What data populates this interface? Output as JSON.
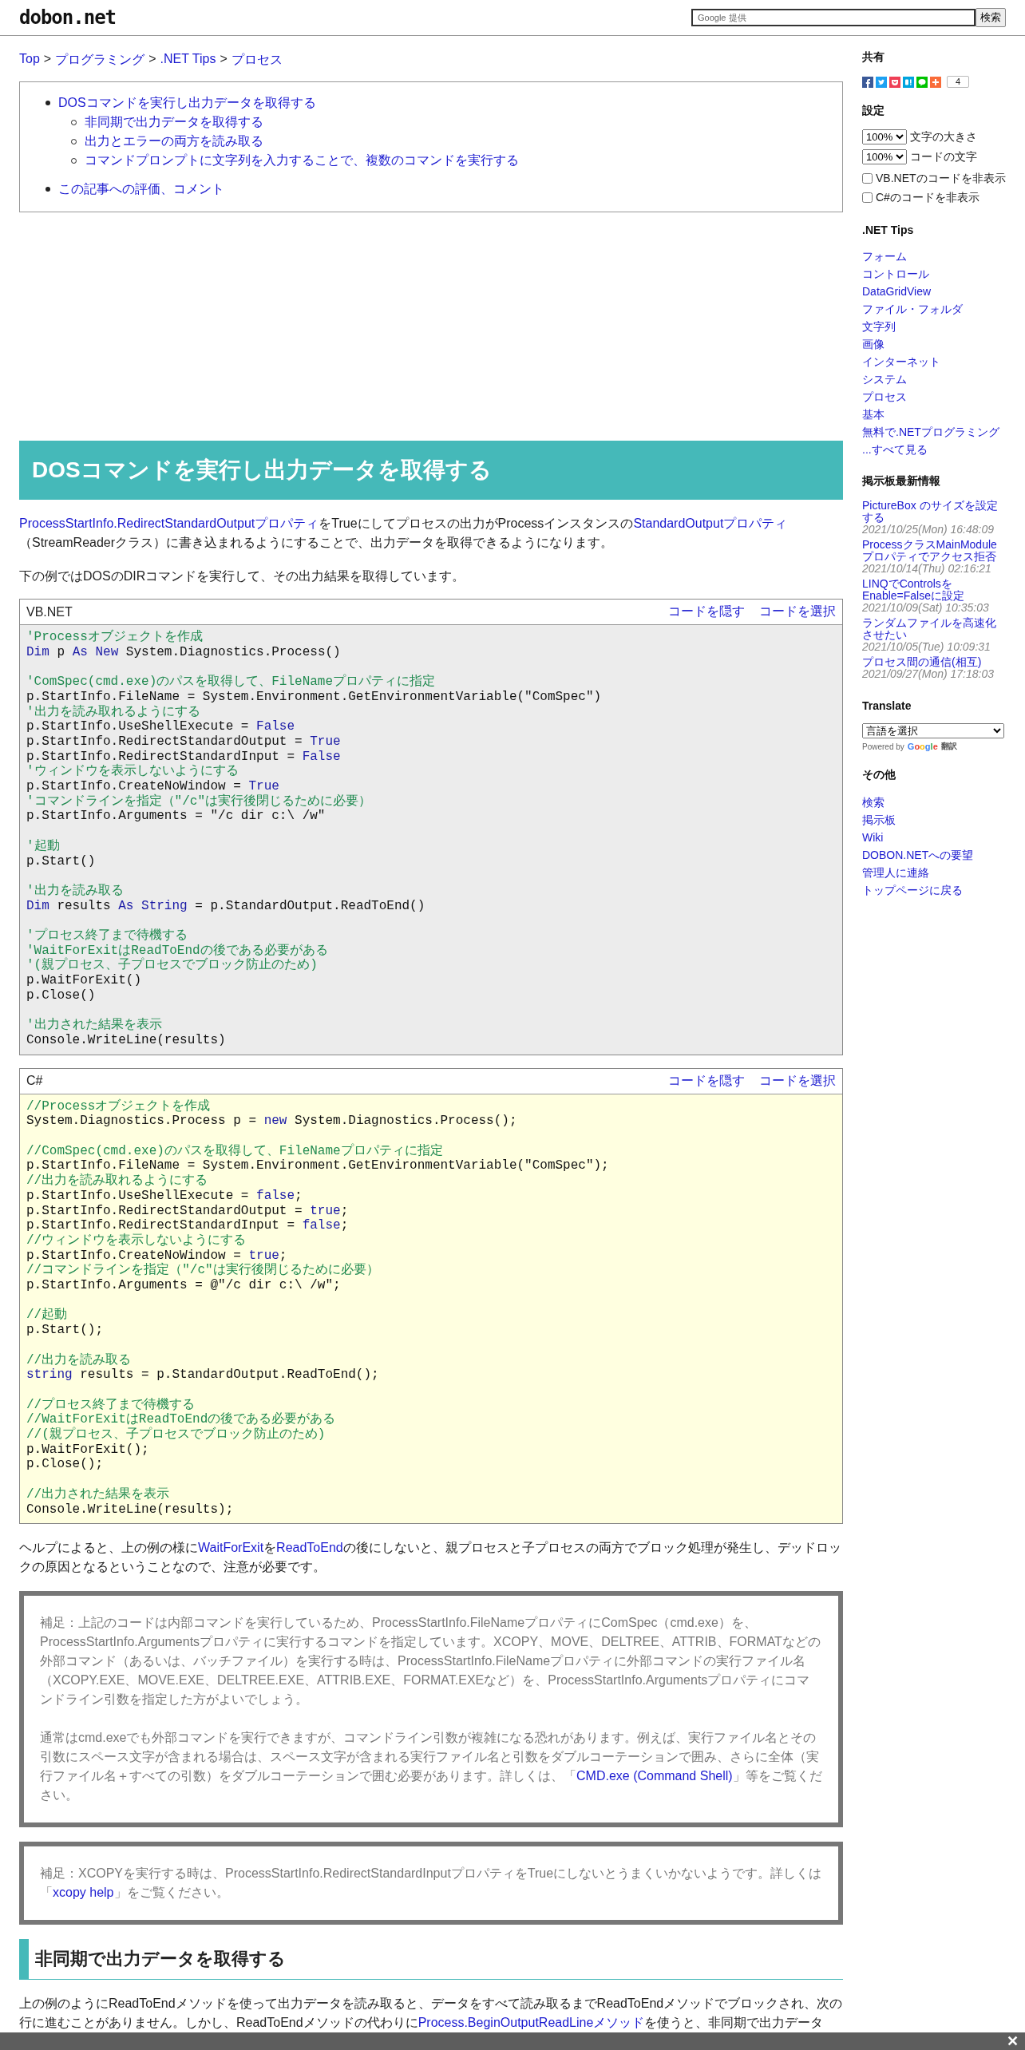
{
  "header": {
    "logo": "dobon.net",
    "search": {
      "placeholder": "Google 提供"
    },
    "search_button": "検索"
  },
  "breadcrumb": {
    "separator": ">",
    "items": [
      {
        "label": "Top"
      },
      {
        "label": "プログラミング"
      },
      {
        "label": ".NET Tips"
      },
      {
        "label": "プロセス"
      }
    ]
  },
  "toc": [
    {
      "label": "DOSコマンドを実行し出力データを取得する",
      "children": [
        {
          "label": "非同期で出力データを取得する"
        },
        {
          "label": "出力とエラーの両方を読み取る"
        },
        {
          "label": "コマンドプロンプトに文字列を入力することで、複数のコマンドを実行する"
        }
      ]
    },
    {
      "label": "この記事への評価、コメント"
    }
  ],
  "article": {
    "heading": "DOSコマンドを実行し出力データを取得する",
    "blocks": [
      {
        "kind": "paragraph",
        "segments": [
          {
            "kind": "link",
            "text": "ProcessStartInfo.RedirectStandardOutputプロパティ"
          },
          {
            "kind": "text",
            "text": "をTrueにしてプロセスの出力がProcessインスタンスの"
          },
          {
            "kind": "link",
            "text": "StandardOutputプロパティ"
          },
          {
            "kind": "text",
            "text": "（StreamReaderクラス）に書き込まれるようにすることで、出力データを取得できるようになります。"
          }
        ]
      },
      {
        "kind": "paragraph",
        "segments": [
          {
            "kind": "text",
            "text": "下の例ではDOSのDIRコマンドを実行して、その出力結果を取得しています。"
          }
        ]
      },
      {
        "kind": "code",
        "language": "VB.NET",
        "color": "#ececec",
        "actions": [
          "コードを隠す",
          "コードを選択"
        ],
        "lines": [
          {
            "kind": "code",
            "tokens": [
              {
                "kind": "comment",
                "text": "'Processオブジェクトを作成"
              }
            ]
          },
          {
            "kind": "code",
            "tokens": [
              {
                "kind": "keyword",
                "text": "Dim"
              },
              {
                "kind": "plain",
                "text": " p "
              },
              {
                "kind": "keyword",
                "text": "As New"
              },
              {
                "kind": "plain",
                "text": " System.Diagnostics.Process()"
              }
            ]
          },
          {
            "kind": "blank"
          },
          {
            "kind": "code",
            "tokens": [
              {
                "kind": "comment",
                "text": "'ComSpec(cmd.exe)のパスを取得して、FileNameプロパティに指定"
              }
            ]
          },
          {
            "kind": "code",
            "tokens": [
              {
                "kind": "plain",
                "text": "p.StartInfo.FileName = System.Environment.GetEnvironmentVariable(\"ComSpec\")"
              }
            ]
          },
          {
            "kind": "code",
            "tokens": [
              {
                "kind": "comment",
                "text": "'出力を読み取れるようにする"
              }
            ]
          },
          {
            "kind": "code",
            "tokens": [
              {
                "kind": "plain",
                "text": "p.StartInfo.UseShellExecute = "
              },
              {
                "kind": "keyword",
                "text": "False"
              }
            ]
          },
          {
            "kind": "code",
            "tokens": [
              {
                "kind": "plain",
                "text": "p.StartInfo.RedirectStandardOutput = "
              },
              {
                "kind": "keyword",
                "text": "True"
              }
            ]
          },
          {
            "kind": "code",
            "tokens": [
              {
                "kind": "plain",
                "text": "p.StartInfo.RedirectStandardInput = "
              },
              {
                "kind": "keyword",
                "text": "False"
              }
            ]
          },
          {
            "kind": "code",
            "tokens": [
              {
                "kind": "comment",
                "text": "'ウィンドウを表示しないようにする"
              }
            ]
          },
          {
            "kind": "code",
            "tokens": [
              {
                "kind": "plain",
                "text": "p.StartInfo.CreateNoWindow = "
              },
              {
                "kind": "keyword",
                "text": "True"
              }
            ]
          },
          {
            "kind": "code",
            "tokens": [
              {
                "kind": "comment",
                "text": "'コマンドラインを指定（\"/c\"は実行後閉じるために必要）"
              }
            ]
          },
          {
            "kind": "code",
            "tokens": [
              {
                "kind": "plain",
                "text": "p.StartInfo.Arguments = \"/c dir c:\\ /w\""
              }
            ]
          },
          {
            "kind": "blank"
          },
          {
            "kind": "code",
            "tokens": [
              {
                "kind": "comment",
                "text": "'起動"
              }
            ]
          },
          {
            "kind": "code",
            "tokens": [
              {
                "kind": "plain",
                "text": "p.Start()"
              }
            ]
          },
          {
            "kind": "blank"
          },
          {
            "kind": "code",
            "tokens": [
              {
                "kind": "comment",
                "text": "'出力を読み取る"
              }
            ]
          },
          {
            "kind": "code",
            "tokens": [
              {
                "kind": "keyword",
                "text": "Dim"
              },
              {
                "kind": "plain",
                "text": " results "
              },
              {
                "kind": "keyword",
                "text": "As String"
              },
              {
                "kind": "plain",
                "text": " = p.StandardOutput.ReadToEnd()"
              }
            ]
          },
          {
            "kind": "blank"
          },
          {
            "kind": "code",
            "tokens": [
              {
                "kind": "comment",
                "text": "'プロセス終了まで待機する"
              }
            ]
          },
          {
            "kind": "code",
            "tokens": [
              {
                "kind": "comment",
                "text": "'WaitForExitはReadToEndの後である必要がある"
              }
            ]
          },
          {
            "kind": "code",
            "tokens": [
              {
                "kind": "comment",
                "text": "'(親プロセス、子プロセスでブロック防止のため)"
              }
            ]
          },
          {
            "kind": "code",
            "tokens": [
              {
                "kind": "plain",
                "text": "p.WaitForExit()"
              }
            ]
          },
          {
            "kind": "code",
            "tokens": [
              {
                "kind": "plain",
                "text": "p.Close()"
              }
            ]
          },
          {
            "kind": "blank"
          },
          {
            "kind": "code",
            "tokens": [
              {
                "kind": "comment",
                "text": "'出力された結果を表示"
              }
            ]
          },
          {
            "kind": "code",
            "tokens": [
              {
                "kind": "plain",
                "text": "Console.WriteLine(results)"
              }
            ]
          }
        ]
      },
      {
        "kind": "code",
        "language": "C#",
        "color": "#ffffe0",
        "actions": [
          "コードを隠す",
          "コードを選択"
        ],
        "lines": [
          {
            "kind": "code",
            "tokens": [
              {
                "kind": "comment",
                "text": "//Processオブジェクトを作成"
              }
            ]
          },
          {
            "kind": "code",
            "tokens": [
              {
                "kind": "plain",
                "text": "System.Diagnostics.Process p = "
              },
              {
                "kind": "keyword",
                "text": "new"
              },
              {
                "kind": "plain",
                "text": " System.Diagnostics.Process();"
              }
            ]
          },
          {
            "kind": "blank"
          },
          {
            "kind": "code",
            "tokens": [
              {
                "kind": "comment",
                "text": "//ComSpec(cmd.exe)のパスを取得して、FileNameプロパティに指定"
              }
            ]
          },
          {
            "kind": "code",
            "tokens": [
              {
                "kind": "plain",
                "text": "p.StartInfo.FileName = System.Environment.GetEnvironmentVariable(\"ComSpec\");"
              }
            ]
          },
          {
            "kind": "code",
            "tokens": [
              {
                "kind": "comment",
                "text": "//出力を読み取れるようにする"
              }
            ]
          },
          {
            "kind": "code",
            "tokens": [
              {
                "kind": "plain",
                "text": "p.StartInfo.UseShellExecute = "
              },
              {
                "kind": "keyword",
                "text": "false"
              },
              {
                "kind": "plain",
                "text": ";"
              }
            ]
          },
          {
            "kind": "code",
            "tokens": [
              {
                "kind": "plain",
                "text": "p.StartInfo.RedirectStandardOutput = "
              },
              {
                "kind": "keyword",
                "text": "true"
              },
              {
                "kind": "plain",
                "text": ";"
              }
            ]
          },
          {
            "kind": "code",
            "tokens": [
              {
                "kind": "plain",
                "text": "p.StartInfo.RedirectStandardInput = "
              },
              {
                "kind": "keyword",
                "text": "false"
              },
              {
                "kind": "plain",
                "text": ";"
              }
            ]
          },
          {
            "kind": "code",
            "tokens": [
              {
                "kind": "comment",
                "text": "//ウィンドウを表示しないようにする"
              }
            ]
          },
          {
            "kind": "code",
            "tokens": [
              {
                "kind": "plain",
                "text": "p.StartInfo.CreateNoWindow = "
              },
              {
                "kind": "keyword",
                "text": "true"
              },
              {
                "kind": "plain",
                "text": ";"
              }
            ]
          },
          {
            "kind": "code",
            "tokens": [
              {
                "kind": "comment",
                "text": "//コマンドラインを指定（\"/c\"は実行後閉じるために必要）"
              }
            ]
          },
          {
            "kind": "code",
            "tokens": [
              {
                "kind": "plain",
                "text": "p.StartInfo.Arguments = @\"/c dir c:\\ /w\";"
              }
            ]
          },
          {
            "kind": "blank"
          },
          {
            "kind": "code",
            "tokens": [
              {
                "kind": "comment",
                "text": "//起動"
              }
            ]
          },
          {
            "kind": "code",
            "tokens": [
              {
                "kind": "plain",
                "text": "p.Start();"
              }
            ]
          },
          {
            "kind": "blank"
          },
          {
            "kind": "code",
            "tokens": [
              {
                "kind": "comment",
                "text": "//出力を読み取る"
              }
            ]
          },
          {
            "kind": "code",
            "tokens": [
              {
                "kind": "keyword",
                "text": "string"
              },
              {
                "kind": "plain",
                "text": " results = p.StandardOutput.ReadToEnd();"
              }
            ]
          },
          {
            "kind": "blank"
          },
          {
            "kind": "code",
            "tokens": [
              {
                "kind": "comment",
                "text": "//プロセス終了まで待機する"
              }
            ]
          },
          {
            "kind": "code",
            "tokens": [
              {
                "kind": "comment",
                "text": "//WaitForExitはReadToEndの後である必要がある"
              }
            ]
          },
          {
            "kind": "code",
            "tokens": [
              {
                "kind": "comment",
                "text": "//(親プロセス、子プロセスでブロック防止のため)"
              }
            ]
          },
          {
            "kind": "code",
            "tokens": [
              {
                "kind": "plain",
                "text": "p.WaitForExit();"
              }
            ]
          },
          {
            "kind": "code",
            "tokens": [
              {
                "kind": "plain",
                "text": "p.Close();"
              }
            ]
          },
          {
            "kind": "blank"
          },
          {
            "kind": "code",
            "tokens": [
              {
                "kind": "comment",
                "text": "//出力された結果を表示"
              }
            ]
          },
          {
            "kind": "code",
            "tokens": [
              {
                "kind": "plain",
                "text": "Console.WriteLine(results);"
              }
            ]
          }
        ]
      },
      {
        "kind": "paragraph",
        "segments": [
          {
            "kind": "text",
            "text": "ヘルプによると、上の例の様に"
          },
          {
            "kind": "link",
            "text": "WaitForExit"
          },
          {
            "kind": "text",
            "text": "を"
          },
          {
            "kind": "link",
            "text": "ReadToEnd"
          },
          {
            "kind": "text",
            "text": "の後にしないと、親プロセスと子プロセスの両方でブロック処理が発生し、デッドロックの原因となるということなので、注意が必要です。"
          }
        ]
      },
      {
        "kind": "note",
        "paragraphs": [
          [
            {
              "kind": "text",
              "text": "補足：上記のコードは内部コマンドを実行しているため、ProcessStartInfo.FileNameプロパティにComSpec（cmd.exe）を、ProcessStartInfo.Argumentsプロパティに実行するコマンドを指定しています。XCOPY、MOVE、DELTREE、ATTRIB、FORMATなどの外部コマンド（あるいは、バッチファイル）を実行する時は、ProcessStartInfo.FileNameプロパティに外部コマンドの実行ファイル名（XCOPY.EXE、MOVE.EXE、DELTREE.EXE、ATTRIB.EXE、FORMAT.EXEなど）を、ProcessStartInfo.Argumentsプロパティにコマンドライン引数を指定した方がよいでしょう。"
            }
          ],
          [
            {
              "kind": "text",
              "text": "通常はcmd.exeでも外部コマンドを実行できますが、コマンドライン引数が複雑になる恐れがあります。例えば、実行ファイル名とその引数にスペース文字が含まれる場合は、スペース文字が含まれる実行ファイル名と引数をダブルコーテーションで囲み、さらに全体（実行ファイル名＋すべての引数）をダブルコーテーションで囲む必要があります。詳しくは、「"
            },
            {
              "kind": "link",
              "text": "CMD.exe (Command Shell)"
            },
            {
              "kind": "text",
              "text": "」等をご覧ください。"
            }
          ]
        ]
      },
      {
        "kind": "note",
        "paragraphs": [
          [
            {
              "kind": "text",
              "text": "補足：XCOPYを実行する時は、ProcessStartInfo.RedirectStandardInputプロパティをTrueにしないとうまくいかないようです。詳しくは「"
            },
            {
              "kind": "link",
              "text": "xcopy help"
            },
            {
              "kind": "text",
              "text": "」をご覧ください。"
            }
          ]
        ]
      },
      {
        "kind": "subheading",
        "text": "非同期で出力データを取得する"
      },
      {
        "kind": "paragraph",
        "segments": [
          {
            "kind": "text",
            "text": "上の例のようにReadToEndメソッドを使って出力データを読み取ると、データをすべて読み取るまでReadToEndメソッドでブロックされ、次の行に進むことがありません。しかし、ReadToEndメソッドの代わりに"
          },
          {
            "kind": "link",
            "text": "Process.BeginOutputReadLineメソッド"
          },
          {
            "kind": "text",
            "text": "を使うと、非同期で出力データ"
          }
        ]
      }
    ]
  },
  "sidebar": {
    "share": {
      "title": "共有",
      "count": "4"
    },
    "settings": {
      "title": "設定",
      "selects": [
        {
          "value": "100%",
          "label": "文字の大きさ"
        },
        {
          "value": "100%",
          "label": "コードの文字"
        }
      ],
      "checkboxes": [
        {
          "label": "VB.NETのコードを非表示",
          "checked": false
        },
        {
          "label": "C#のコードを非表示",
          "checked": false
        }
      ]
    },
    "tips": {
      "title": ".NET Tips",
      "links": [
        "フォーム",
        "コントロール",
        "DataGridView",
        "ファイル・フォルダ",
        "文字列",
        "画像",
        "インターネット",
        "システム",
        "プロセス",
        "基本",
        "無料で.NETプログラミング",
        "...すべて見る"
      ]
    },
    "board": {
      "title": "掲示板最新情報",
      "posts": [
        {
          "title": "PictureBox のサイズを設定する",
          "date": "2021/10/25(Mon) 16:48:09"
        },
        {
          "title": "ProcessクラスMainModuleプロパティでアクセス拒否",
          "date": "2021/10/14(Thu) 02:16:21"
        },
        {
          "title": "LINQでControlsをEnable=Falseに設定",
          "date": "2021/10/09(Sat) 10:35:03"
        },
        {
          "title": "ランダムファイルを高速化させたい",
          "date": "2021/10/05(Tue) 10:09:31"
        },
        {
          "title": "プロセス間の通信(相互)",
          "date": "2021/09/27(Mon) 17:18:03"
        }
      ]
    },
    "translate": {
      "title": "Translate",
      "select": "言語を選択",
      "powered_by": "Powered by",
      "google": "Google",
      "translate_word": "翻訳"
    },
    "other": {
      "title": "その他",
      "links": [
        "検索",
        "掲示板",
        "Wiki",
        "DOBON.NETへの要望",
        "管理人に連絡",
        "トップページに戻る"
      ]
    }
  },
  "overlay": {
    "close": "✕"
  }
}
